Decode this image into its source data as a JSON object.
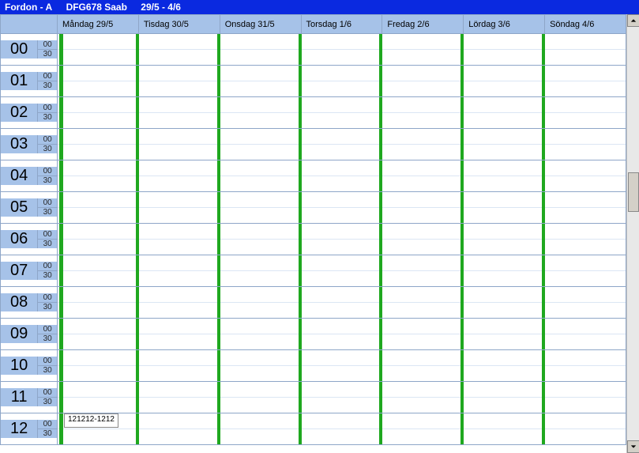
{
  "title": {
    "prefix": "Fordon  -  A",
    "vehicle": "DFG678 Saab",
    "range": "29/5 - 4/6"
  },
  "subslots": [
    "00",
    "30"
  ],
  "days": [
    "Måndag 29/5",
    "Tisdag 30/5",
    "Onsdag 31/5",
    "Torsdag 1/6",
    "Fredag 2/6",
    "Lördag 3/6",
    "Söndag 4/6"
  ],
  "hours": [
    "00",
    "01",
    "02",
    "03",
    "04",
    "05",
    "06",
    "07",
    "08",
    "09",
    "10",
    "11",
    "12"
  ],
  "events": [
    {
      "hourIndex": 12,
      "dayIndex": 0,
      "label": "121212-1212"
    }
  ]
}
